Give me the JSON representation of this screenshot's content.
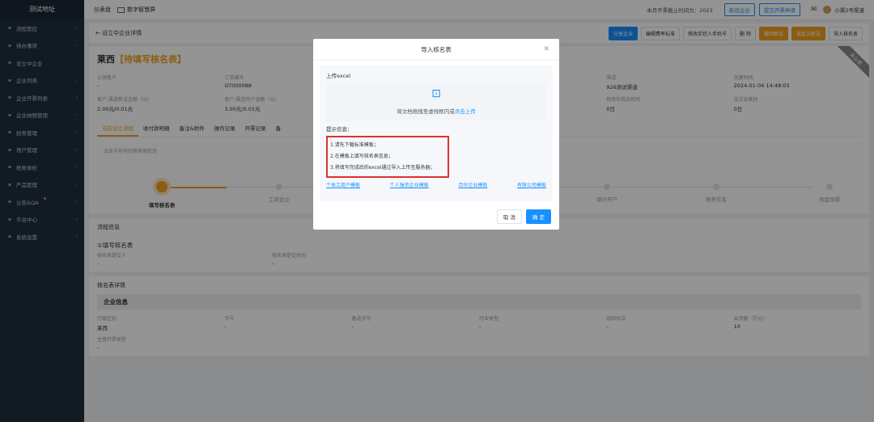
{
  "sidebar": {
    "title": "测试地址",
    "items": [
      {
        "label": "流程管控",
        "icon": "flow-icon"
      },
      {
        "label": "待办事项",
        "icon": "todo-icon"
      },
      {
        "label": "设立中企业",
        "icon": "building-icon"
      },
      {
        "label": "企业列表",
        "icon": "list-icon"
      },
      {
        "label": "企业开票列表",
        "icon": "invoice-icon"
      },
      {
        "label": "企业纳税管理",
        "icon": "tax-icon"
      },
      {
        "label": "财务管理",
        "icon": "finance-icon"
      },
      {
        "label": "用户管理",
        "icon": "user-icon"
      },
      {
        "label": "税务体检",
        "icon": "check-icon"
      },
      {
        "label": "产品管理",
        "icon": "product-icon"
      },
      {
        "label": "公告&QA",
        "icon": "notice-icon"
      },
      {
        "label": "平台中心",
        "icon": "platform-icon"
      },
      {
        "label": "系统设置",
        "icon": "settings-icon"
      }
    ]
  },
  "topbar": {
    "dashboard": "仪表盘",
    "tab": "数字智慧屏",
    "notice": "本月开票截止时间为：2023",
    "new_company": "新设企业",
    "submit_invoice": "提交开票申请",
    "user": "小渠2号渠道"
  },
  "subhead": {
    "back": "← 设立中企业详情",
    "actions": [
      {
        "label": "分享企业",
        "style": "blue"
      },
      {
        "label": "编辑费率标准",
        "style": "plain"
      },
      {
        "label": "修改实控人手机号",
        "style": "plain"
      },
      {
        "label": "删 除",
        "style": "plain"
      },
      {
        "label": "撤回新设",
        "style": "orange"
      },
      {
        "label": "自定义新设",
        "style": "orange"
      },
      {
        "label": "导入核名表",
        "style": "plain"
      }
    ]
  },
  "company": {
    "name": "莱西",
    "status": "【待填写核名表】",
    "ribbon": "未认领"
  },
  "info": [
    {
      "label": "认领客户",
      "value": "-"
    },
    {
      "label": "订单编号",
      "value": "GT000088"
    },
    {
      "label": "",
      "value": ""
    },
    {
      "label": "",
      "value": ""
    },
    {
      "label": "渠道",
      "value": "926测试渠道"
    },
    {
      "label": "创建时间",
      "value": "2024-01-04 14:48:03"
    },
    {
      "label": "客户:渠道新设金额（元）",
      "value": "2.00元/0.01元"
    },
    {
      "label": "客户:渠道开户金额（元）",
      "value": "3.00元/0.01元"
    },
    {
      "label": "",
      "value": ""
    },
    {
      "label": "",
      "value": ""
    },
    {
      "label": "税务阶段总耗时",
      "value": "0日"
    },
    {
      "label": "设立总耗时",
      "value": "0日"
    }
  ],
  "tabs": [
    "当前设立流程",
    "收付款明细",
    "备注&附件",
    "操作记录",
    "开票记录",
    "备"
  ],
  "flow": {
    "hint": "点击节号可切换其他状态",
    "steps": [
      "填写核名表",
      "工商设立",
      "",
      "",
      "银行开户",
      "税务实名",
      "领盘领票"
    ]
  },
  "flow_info": {
    "title": "流程信息",
    "sub": "①填写核名表",
    "fields": [
      {
        "label": "核名表提交人",
        "value": "-"
      },
      {
        "label": "核名表提交时间",
        "value": "-"
      }
    ]
  },
  "detail": {
    "title": "核名表详情",
    "enterprise": "企业信息",
    "fields": [
      {
        "label": "行政区划",
        "value": "莱西"
      },
      {
        "label": "字号",
        "value": "-"
      },
      {
        "label": "备选字号",
        "value": "-"
      },
      {
        "label": "行业类型",
        "value": "-"
      },
      {
        "label": "组织形式",
        "value": "-"
      },
      {
        "label": "出资额（万元）",
        "value": "10"
      }
    ],
    "extra_label": "主营开票类型",
    "extra_value": "-"
  },
  "modal": {
    "title": "导入核名表",
    "upload_label": "上传excel",
    "drop_text": "将文档拖拽至虚线框内或",
    "drop_link": "点击上传",
    "hint_title": "提示信息：",
    "hints": [
      "1.请先下载标准模板；",
      "2.在模板上填写核名表信息；",
      "3.将填写完成后的excel通过导入上传至服务器；"
    ],
    "templates": [
      "个体工商户模板",
      "个人独资企业模板",
      "合伙企业模板",
      "有限公司模板"
    ],
    "cancel": "取 消",
    "confirm": "确 定"
  }
}
